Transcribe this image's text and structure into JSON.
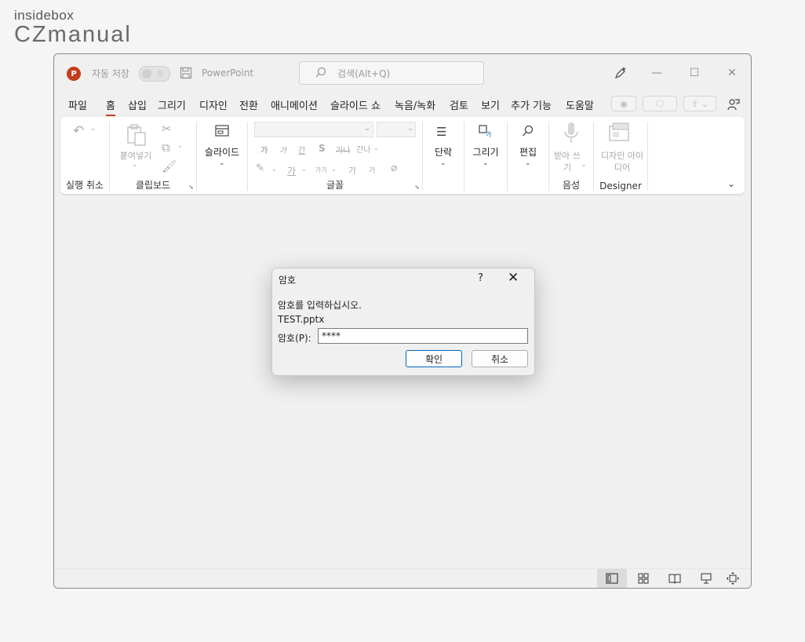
{
  "watermark": {
    "line1": "insidebox",
    "line2": "CZmanual"
  },
  "titlebar": {
    "autosave_label": "자동 저장",
    "autosave_state": "끔",
    "app_name": "PowerPoint",
    "search_placeholder": "검색(Alt+Q)"
  },
  "menu": [
    "파일",
    "홈",
    "삽입",
    "그리기",
    "디자인",
    "전환",
    "애니메이션",
    "슬라이드 쇼",
    "녹음/녹화",
    "검토",
    "보기",
    "추가 기능",
    "도움말"
  ],
  "ribbon": {
    "undo_group": "실행 취소",
    "clipboard_group": "클립보드",
    "paste_label": "붙여넣기",
    "slide_label": "슬라이드",
    "font_group": "글꼴",
    "font_glyphs": [
      "가",
      "가",
      "간",
      "S",
      "가나",
      "간나"
    ],
    "font_glyphs2": [
      "가",
      "가가",
      "가",
      "가"
    ],
    "paragraph_label": "단락",
    "drawing_label": "그리기",
    "editing_label": "편집",
    "dictate_label": "받아 쓰기",
    "voice_group": "음성",
    "designer_label": "디자인 아이디어",
    "designer_group": "Designer"
  },
  "dialog": {
    "title": "암호",
    "help": "?",
    "prompt": "암호를 입력하십시오.",
    "filename": "TEST.pptx",
    "password_label": "암호(P):",
    "password_value": "****",
    "ok": "확인",
    "cancel": "취소"
  },
  "statusbar": {
    "views": [
      "normal-view-icon",
      "slide-sorter-icon",
      "reading-view-icon",
      "slideshow-icon",
      "fit-to-window-icon"
    ]
  }
}
